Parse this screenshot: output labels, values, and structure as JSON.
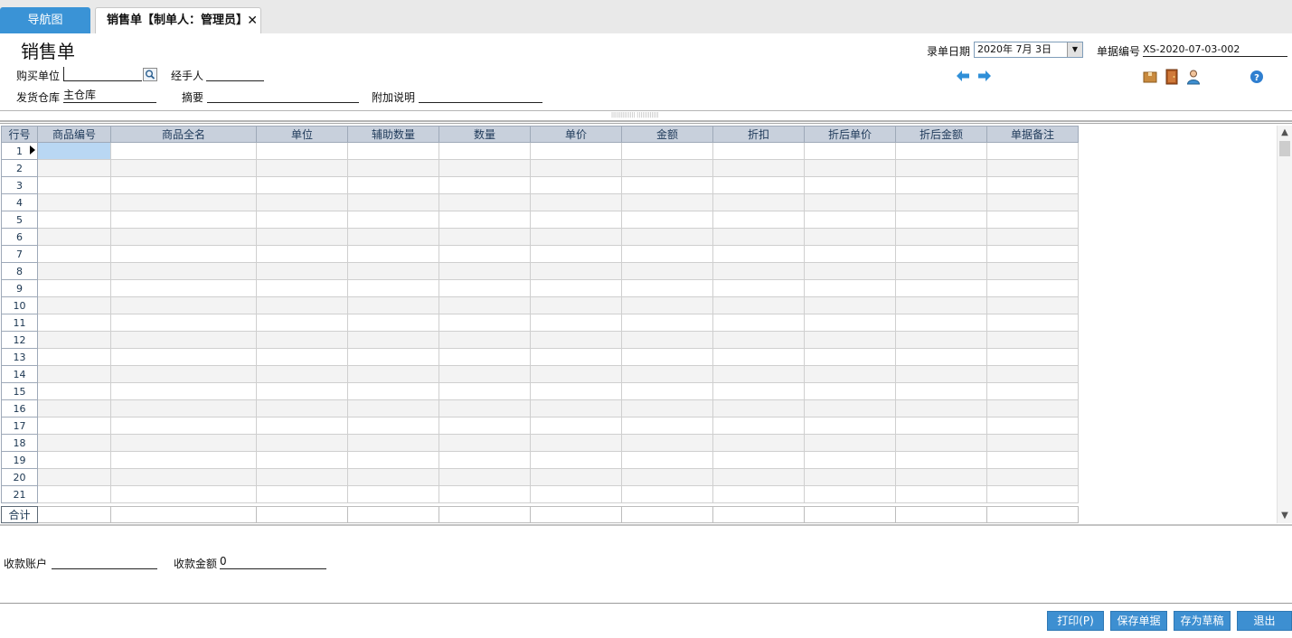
{
  "tabs": {
    "nav_label": "导航图",
    "active_label": "销售单【制单人：管理员】",
    "close_glyph": "✕"
  },
  "page_title": "销售单",
  "form": {
    "buyer_label": "购买单位",
    "buyer_value": "",
    "handler_label": "经手人",
    "handler_value": "",
    "warehouse_label": "发货仓库",
    "warehouse_value": "主仓库",
    "summary_label": "摘要",
    "summary_value": "",
    "note_label": "附加说明",
    "note_value": "",
    "date_label": "录单日期",
    "date_value": "2020年 7月 3日",
    "docno_label": "单据编号",
    "docno_value": "XS-2020-07-03-002"
  },
  "grid": {
    "columns": [
      "行号",
      "商品编号",
      "商品全名",
      "单位",
      "辅助数量",
      "数量",
      "单价",
      "金额",
      "折扣",
      "折后单价",
      "折后金额",
      "单据备注"
    ],
    "rows": [
      "1",
      "2",
      "3",
      "4",
      "5",
      "6",
      "7",
      "8",
      "9",
      "10",
      "11",
      "12",
      "13",
      "14",
      "15",
      "16",
      "17",
      "18",
      "19",
      "20",
      "21"
    ],
    "total_label": "合计"
  },
  "footer": {
    "account_label": "收款账户",
    "account_value": "",
    "amount_label": "收款金额",
    "amount_value": "0"
  },
  "buttons": {
    "print": "打印(P)",
    "save": "保存单据",
    "draft": "存为草稿",
    "exit": "退出"
  },
  "colors": {
    "accent": "#3a93d6",
    "grid_header": "#c8d0dc",
    "selected_cell": "#b9d7f3"
  },
  "icons": [
    "arrow-left-icon",
    "arrow-right-icon",
    "package-icon",
    "door-icon",
    "user-icon",
    "help-icon"
  ]
}
